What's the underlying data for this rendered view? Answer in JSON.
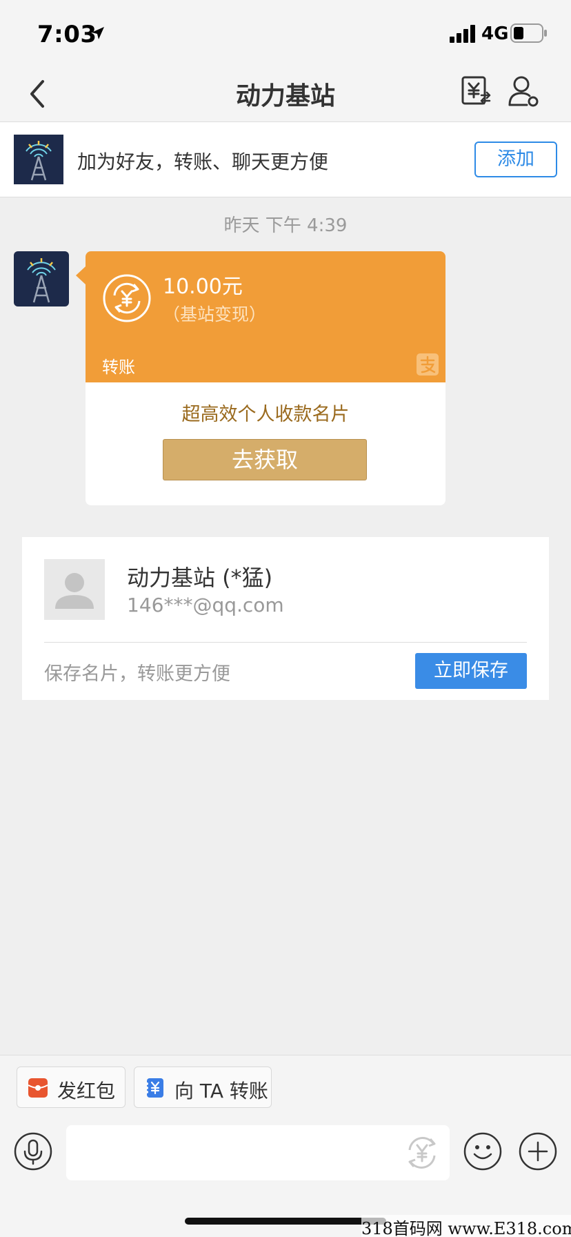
{
  "status_bar": {
    "time": "7:03",
    "network": "4G"
  },
  "nav": {
    "title": "动力基站"
  },
  "banner": {
    "text": "加为好友，转账、聊天更方便",
    "add_label": "添加"
  },
  "chat": {
    "timestamp": "昨天 下午 4:39",
    "transfer": {
      "amount": "10.00元",
      "memo": "（基站变现）",
      "label": "转账",
      "promo": "超高效个人收款名片",
      "action_label": "去获取"
    }
  },
  "contact_card": {
    "name": "动力基站 (*猛)",
    "email": "146***@qq.com",
    "save_hint": "保存名片，转账更方便",
    "save_label": "立即保存"
  },
  "quick_actions": [
    {
      "label": "发红包",
      "icon": "red-packet-icon",
      "color": "#e8552f"
    },
    {
      "label": "向 TA 转账",
      "icon": "transfer-icon",
      "color": "#3a7de6"
    }
  ],
  "input": {
    "placeholder": ""
  },
  "watermark": "318首码网  www.E318.com",
  "colors": {
    "accent": "#2d8ae6",
    "transfer_card": "#f19d38",
    "gold_button": "#d5ad6a"
  }
}
